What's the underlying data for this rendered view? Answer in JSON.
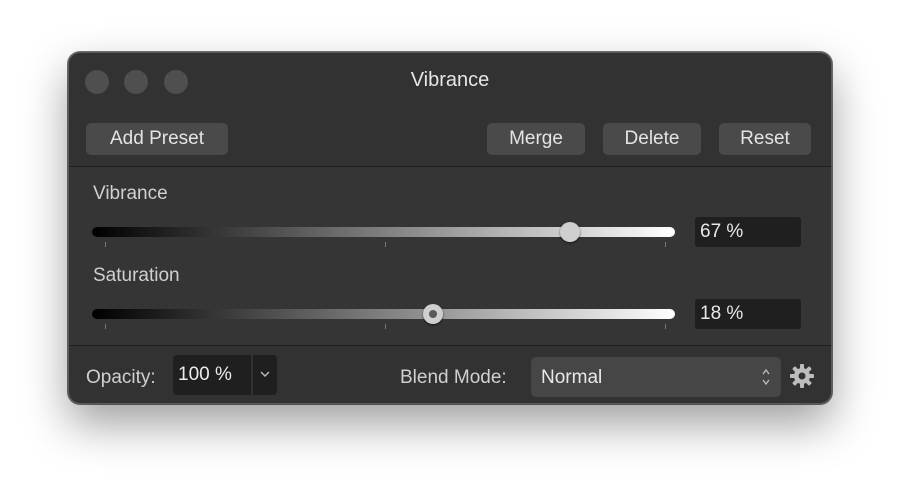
{
  "window": {
    "title": "Vibrance"
  },
  "toolbar": {
    "add_preset_label": "Add Preset",
    "merge_label": "Merge",
    "delete_label": "Delete",
    "reset_label": "Reset"
  },
  "adjustments": {
    "vibrance": {
      "label": "Vibrance",
      "value_text": "67 %",
      "slider_position": 0.82
    },
    "saturation": {
      "label": "Saturation",
      "value_text": "18 %",
      "slider_position": 0.585
    }
  },
  "footer": {
    "opacity_label": "Opacity:",
    "opacity_value": "100 %",
    "blend_mode_label": "Blend Mode:",
    "blend_mode_value": "Normal"
  },
  "icons": {
    "window_controls": [
      "close-icon",
      "minimize-icon",
      "zoom-icon"
    ],
    "opacity_dropdown": "chevron-down-icon",
    "blend_mode_select": "up-down-arrows-icon",
    "settings": "gear-icon"
  },
  "colors": {
    "window_background": "#323232",
    "panel_background": "#353535",
    "button_background": "#4a4a4a",
    "field_background": "#1f1f1f"
  }
}
